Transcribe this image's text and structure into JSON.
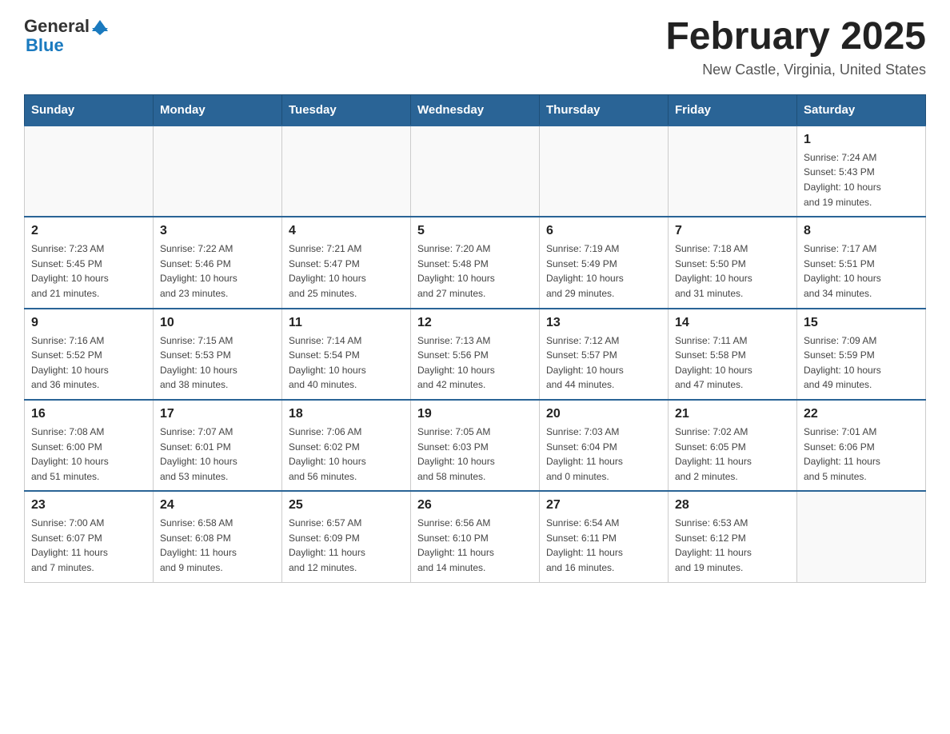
{
  "header": {
    "logo_general": "General",
    "logo_blue": "Blue",
    "month_title": "February 2025",
    "location": "New Castle, Virginia, United States"
  },
  "days_of_week": [
    "Sunday",
    "Monday",
    "Tuesday",
    "Wednesday",
    "Thursday",
    "Friday",
    "Saturday"
  ],
  "weeks": [
    [
      {
        "day": "",
        "info": ""
      },
      {
        "day": "",
        "info": ""
      },
      {
        "day": "",
        "info": ""
      },
      {
        "day": "",
        "info": ""
      },
      {
        "day": "",
        "info": ""
      },
      {
        "day": "",
        "info": ""
      },
      {
        "day": "1",
        "info": "Sunrise: 7:24 AM\nSunset: 5:43 PM\nDaylight: 10 hours\nand 19 minutes."
      }
    ],
    [
      {
        "day": "2",
        "info": "Sunrise: 7:23 AM\nSunset: 5:45 PM\nDaylight: 10 hours\nand 21 minutes."
      },
      {
        "day": "3",
        "info": "Sunrise: 7:22 AM\nSunset: 5:46 PM\nDaylight: 10 hours\nand 23 minutes."
      },
      {
        "day": "4",
        "info": "Sunrise: 7:21 AM\nSunset: 5:47 PM\nDaylight: 10 hours\nand 25 minutes."
      },
      {
        "day": "5",
        "info": "Sunrise: 7:20 AM\nSunset: 5:48 PM\nDaylight: 10 hours\nand 27 minutes."
      },
      {
        "day": "6",
        "info": "Sunrise: 7:19 AM\nSunset: 5:49 PM\nDaylight: 10 hours\nand 29 minutes."
      },
      {
        "day": "7",
        "info": "Sunrise: 7:18 AM\nSunset: 5:50 PM\nDaylight: 10 hours\nand 31 minutes."
      },
      {
        "day": "8",
        "info": "Sunrise: 7:17 AM\nSunset: 5:51 PM\nDaylight: 10 hours\nand 34 minutes."
      }
    ],
    [
      {
        "day": "9",
        "info": "Sunrise: 7:16 AM\nSunset: 5:52 PM\nDaylight: 10 hours\nand 36 minutes."
      },
      {
        "day": "10",
        "info": "Sunrise: 7:15 AM\nSunset: 5:53 PM\nDaylight: 10 hours\nand 38 minutes."
      },
      {
        "day": "11",
        "info": "Sunrise: 7:14 AM\nSunset: 5:54 PM\nDaylight: 10 hours\nand 40 minutes."
      },
      {
        "day": "12",
        "info": "Sunrise: 7:13 AM\nSunset: 5:56 PM\nDaylight: 10 hours\nand 42 minutes."
      },
      {
        "day": "13",
        "info": "Sunrise: 7:12 AM\nSunset: 5:57 PM\nDaylight: 10 hours\nand 44 minutes."
      },
      {
        "day": "14",
        "info": "Sunrise: 7:11 AM\nSunset: 5:58 PM\nDaylight: 10 hours\nand 47 minutes."
      },
      {
        "day": "15",
        "info": "Sunrise: 7:09 AM\nSunset: 5:59 PM\nDaylight: 10 hours\nand 49 minutes."
      }
    ],
    [
      {
        "day": "16",
        "info": "Sunrise: 7:08 AM\nSunset: 6:00 PM\nDaylight: 10 hours\nand 51 minutes."
      },
      {
        "day": "17",
        "info": "Sunrise: 7:07 AM\nSunset: 6:01 PM\nDaylight: 10 hours\nand 53 minutes."
      },
      {
        "day": "18",
        "info": "Sunrise: 7:06 AM\nSunset: 6:02 PM\nDaylight: 10 hours\nand 56 minutes."
      },
      {
        "day": "19",
        "info": "Sunrise: 7:05 AM\nSunset: 6:03 PM\nDaylight: 10 hours\nand 58 minutes."
      },
      {
        "day": "20",
        "info": "Sunrise: 7:03 AM\nSunset: 6:04 PM\nDaylight: 11 hours\nand 0 minutes."
      },
      {
        "day": "21",
        "info": "Sunrise: 7:02 AM\nSunset: 6:05 PM\nDaylight: 11 hours\nand 2 minutes."
      },
      {
        "day": "22",
        "info": "Sunrise: 7:01 AM\nSunset: 6:06 PM\nDaylight: 11 hours\nand 5 minutes."
      }
    ],
    [
      {
        "day": "23",
        "info": "Sunrise: 7:00 AM\nSunset: 6:07 PM\nDaylight: 11 hours\nand 7 minutes."
      },
      {
        "day": "24",
        "info": "Sunrise: 6:58 AM\nSunset: 6:08 PM\nDaylight: 11 hours\nand 9 minutes."
      },
      {
        "day": "25",
        "info": "Sunrise: 6:57 AM\nSunset: 6:09 PM\nDaylight: 11 hours\nand 12 minutes."
      },
      {
        "day": "26",
        "info": "Sunrise: 6:56 AM\nSunset: 6:10 PM\nDaylight: 11 hours\nand 14 minutes."
      },
      {
        "day": "27",
        "info": "Sunrise: 6:54 AM\nSunset: 6:11 PM\nDaylight: 11 hours\nand 16 minutes."
      },
      {
        "day": "28",
        "info": "Sunrise: 6:53 AM\nSunset: 6:12 PM\nDaylight: 11 hours\nand 19 minutes."
      },
      {
        "day": "",
        "info": ""
      }
    ]
  ]
}
